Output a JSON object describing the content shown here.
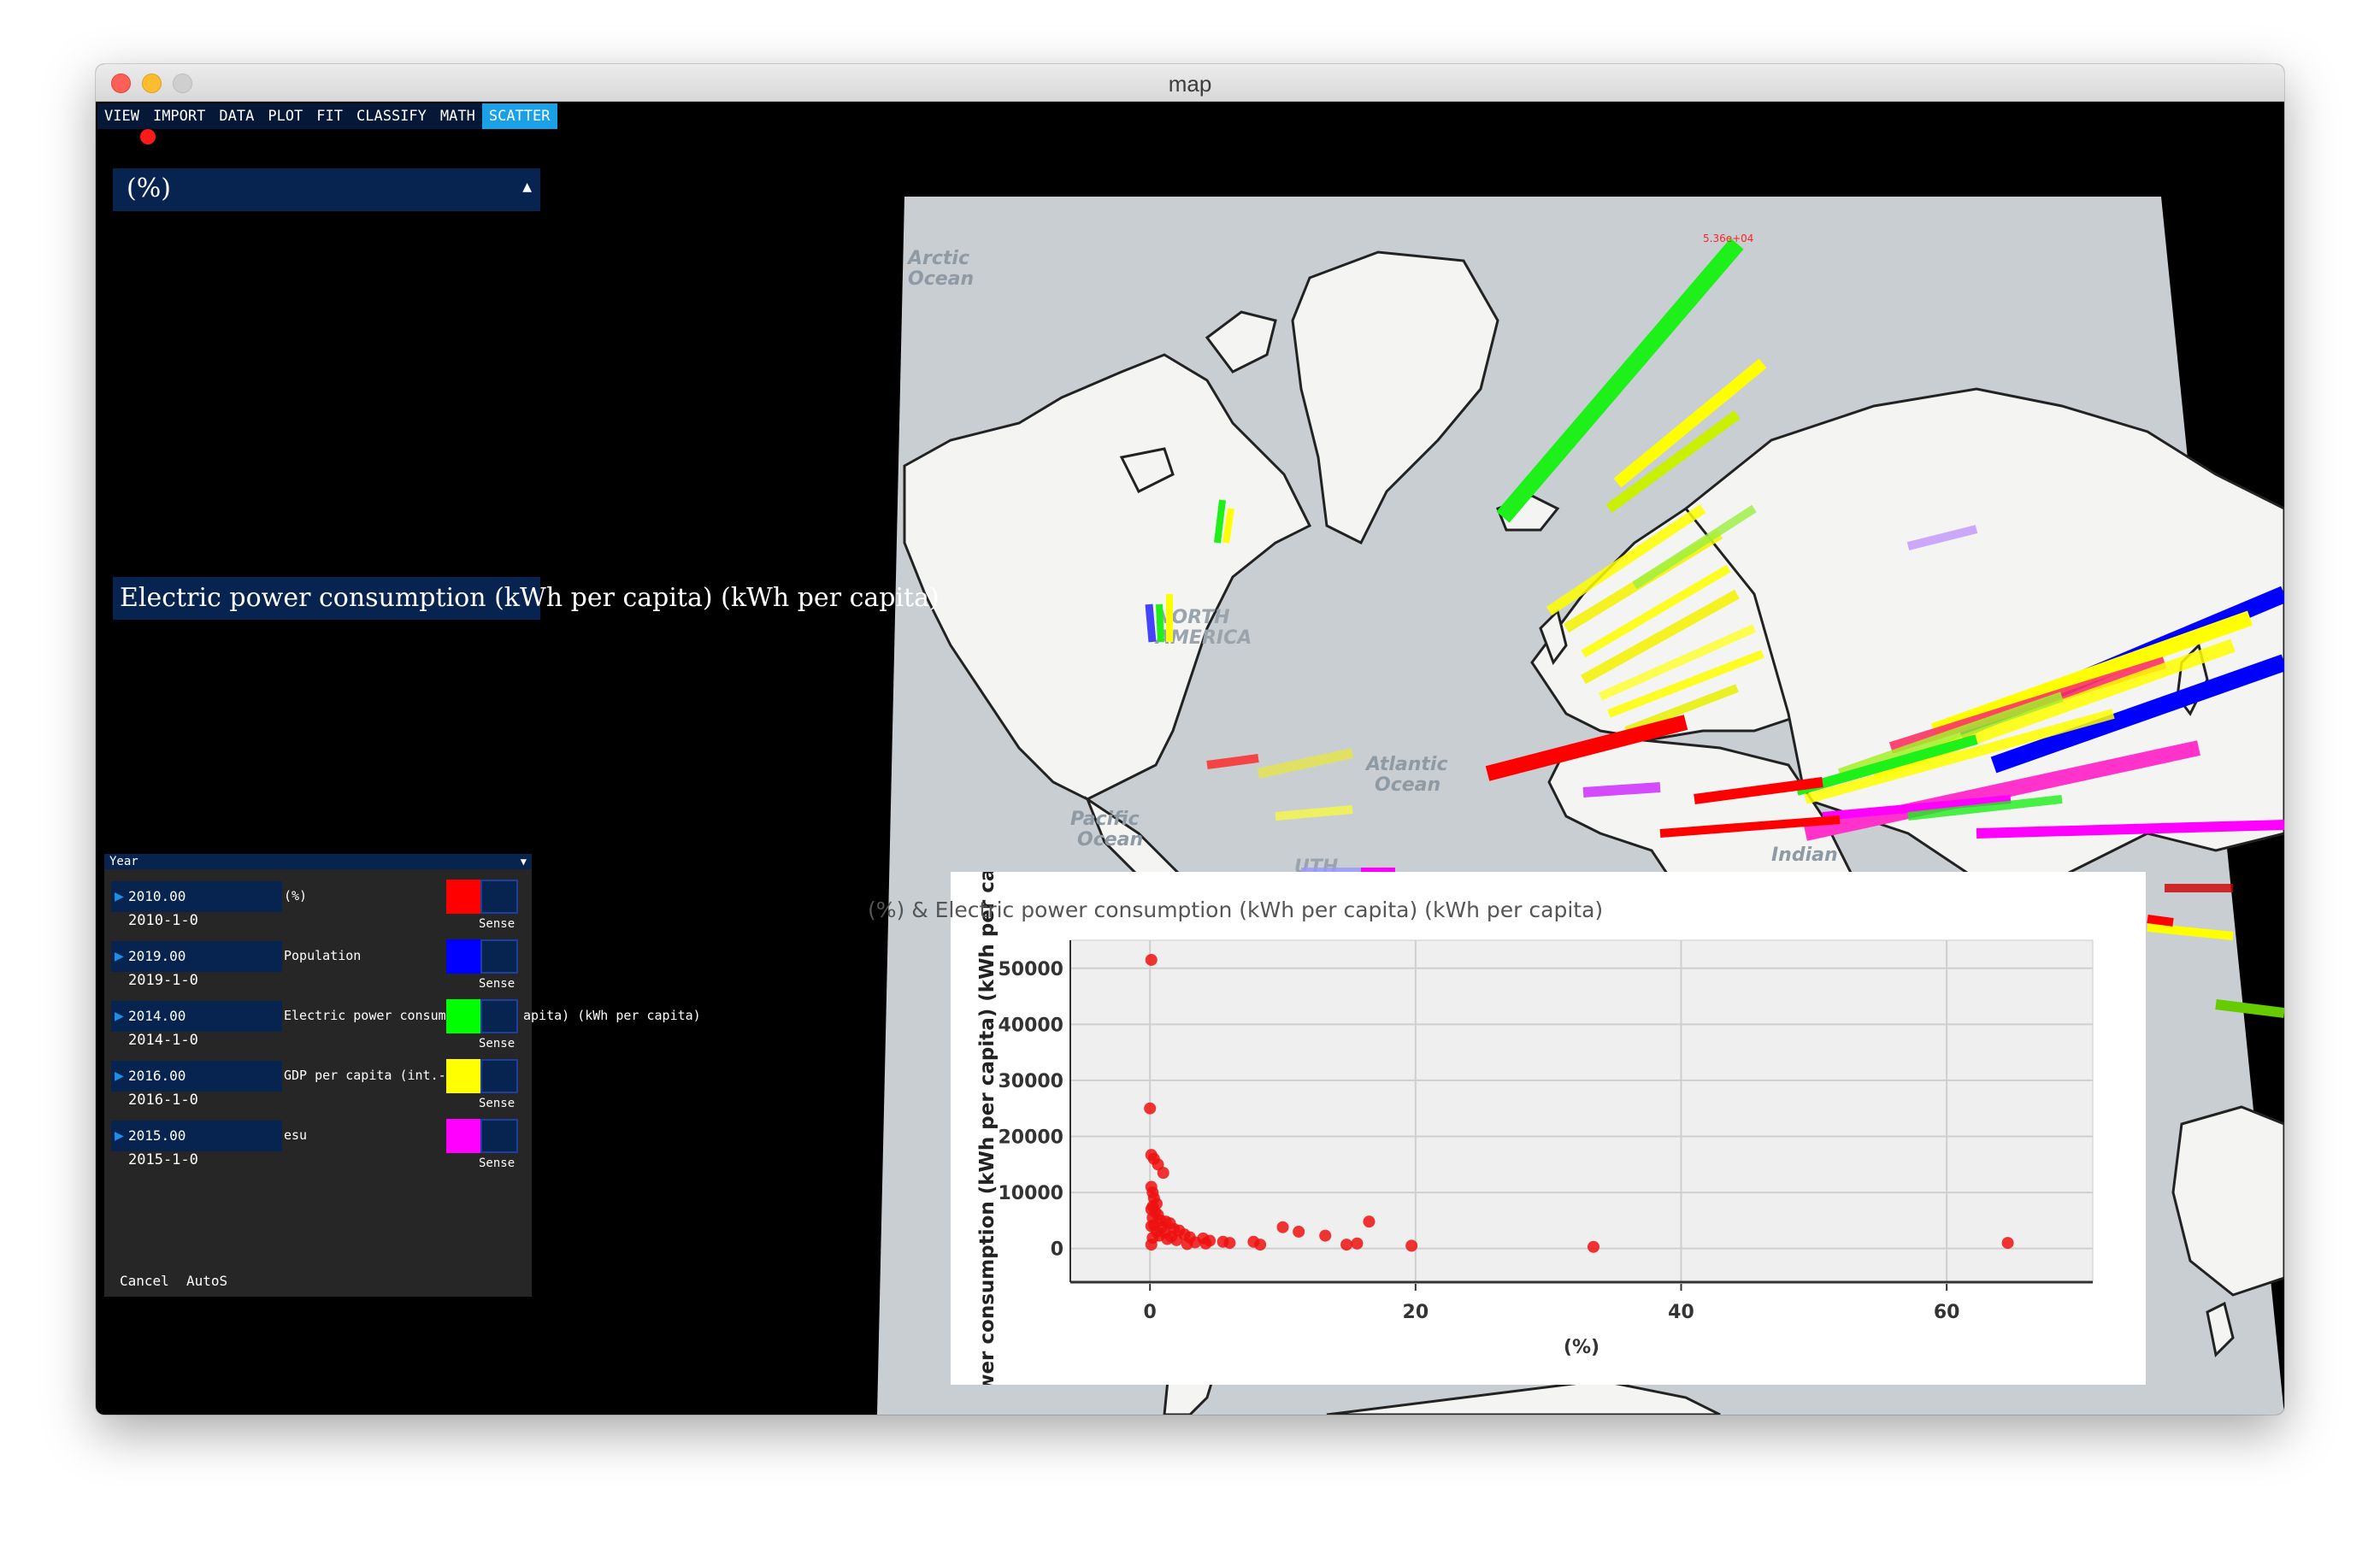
{
  "window": {
    "title": "map"
  },
  "menu": [
    {
      "label": "VIEW"
    },
    {
      "label": "IMPORT"
    },
    {
      "label": "DATA"
    },
    {
      "label": "PLOT"
    },
    {
      "label": "FIT"
    },
    {
      "label": "CLASSIFY"
    },
    {
      "label": "MATH"
    },
    {
      "label": "SCATTER",
      "active": true
    }
  ],
  "x_variable": {
    "label": "(%)"
  },
  "y_variable": {
    "label": "Electric power consumption (kWh per capita) (kWh per capita)"
  },
  "panel": {
    "header": "Year",
    "rows": [
      {
        "value": "2010.00",
        "date": "2010-1-0",
        "name": "(%)",
        "color": "#ff0000",
        "sense": "Sense"
      },
      {
        "value": "2019.00",
        "date": "2019-1-0",
        "name": "Population",
        "color": "#0000ff",
        "sense": "Sense"
      },
      {
        "value": "2014.00",
        "date": "2014-1-0",
        "name": "Electric power consumptio",
        "name_tail": "apita) (kWh per capita)",
        "color": "#00ff00",
        "sense": "Sense"
      },
      {
        "value": "2016.00",
        "date": "2016-1-0",
        "name": "GDP per capita (int.-$) ($",
        "color": "#ffff00",
        "sense": "Sense"
      },
      {
        "value": "2015.00",
        "date": "2015-1-0",
        "name": "esu",
        "color": "#ff00ff",
        "sense": "Sense"
      }
    ],
    "cancel_label": "Cancel",
    "autos_label": "AutoS"
  },
  "map": {
    "labels": {
      "arctic": "Arctic\nOcean",
      "north_america": "NORTH\nAMERICA",
      "atlantic": "Atlantic\nOcean",
      "pacific": "Pacific\nOcean",
      "indian": "Indian",
      "south": "UTH"
    },
    "bar_label_top": "5.36e+04"
  },
  "chart_data": {
    "type": "scatter",
    "title": "(%) & Electric power consumption (kWh per capita) (kWh per capita)",
    "xlabel": "(%)",
    "ylabel": "Electric power consumption (kWh per capita) (kWh per capita)",
    "xlim": [
      -6,
      71
    ],
    "ylim": [
      -6000,
      55000
    ],
    "xticks": [
      0,
      20,
      40,
      60
    ],
    "yticks": [
      0,
      10000,
      20000,
      30000,
      40000,
      50000
    ],
    "grid": true,
    "color": "#ee1111",
    "points": [
      [
        0.1,
        51500
      ],
      [
        0.0,
        25000
      ],
      [
        0.1,
        16700
      ],
      [
        0.3,
        16000
      ],
      [
        0.6,
        15000
      ],
      [
        1.0,
        13500
      ],
      [
        0.1,
        11000
      ],
      [
        0.2,
        10000
      ],
      [
        0.3,
        9000
      ],
      [
        0.5,
        8000
      ],
      [
        0.2,
        7500
      ],
      [
        0.1,
        7000
      ],
      [
        0.4,
        6500
      ],
      [
        0.6,
        6000
      ],
      [
        0.2,
        5500
      ],
      [
        0.8,
        5000
      ],
      [
        1.2,
        4800
      ],
      [
        1.5,
        4500
      ],
      [
        0.3,
        4200
      ],
      [
        0.1,
        4000
      ],
      [
        0.9,
        3800
      ],
      [
        1.8,
        3500
      ],
      [
        2.2,
        3200
      ],
      [
        0.5,
        3000
      ],
      [
        1.1,
        2800
      ],
      [
        2.6,
        2500
      ],
      [
        0.7,
        2300
      ],
      [
        1.6,
        2100
      ],
      [
        3.0,
        2000
      ],
      [
        0.2,
        1900
      ],
      [
        1.3,
        1700
      ],
      [
        2.0,
        1500
      ],
      [
        4.0,
        1800
      ],
      [
        4.5,
        1400
      ],
      [
        5.5,
        1200
      ],
      [
        3.4,
        1100
      ],
      [
        6.0,
        1000
      ],
      [
        4.2,
        900
      ],
      [
        2.8,
        800
      ],
      [
        0.1,
        700
      ],
      [
        7.8,
        1200
      ],
      [
        8.3,
        700
      ],
      [
        10.0,
        3800
      ],
      [
        11.2,
        3000
      ],
      [
        13.2,
        2300
      ],
      [
        14.8,
        700
      ],
      [
        15.6,
        900
      ],
      [
        16.5,
        4800
      ],
      [
        19.7,
        500
      ],
      [
        33.4,
        300
      ],
      [
        64.6,
        1000
      ]
    ]
  }
}
